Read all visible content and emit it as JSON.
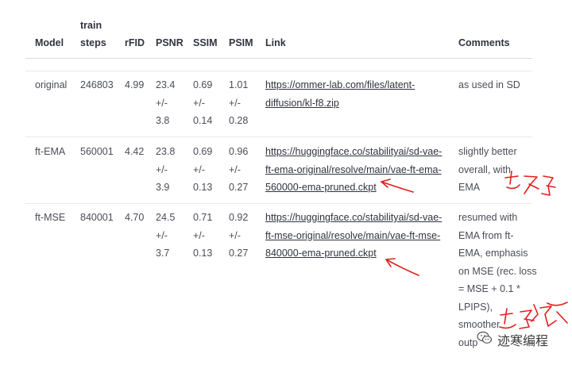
{
  "table": {
    "headers": {
      "model": "Model",
      "train_line1": "train",
      "train_line2": "steps",
      "rfid": "rFID",
      "psnr": "PSNR",
      "ssim": "SSIM",
      "psim": "PSIM",
      "link": "Link",
      "comments": "Comments"
    },
    "rows": [
      {
        "model": "original",
        "steps": "246803",
        "rfid": "4.99",
        "psnr": [
          "23.4",
          "+/-",
          "3.8"
        ],
        "ssim": [
          "0.69",
          "+/-",
          "0.14"
        ],
        "psim": [
          "1.01",
          "+/-",
          "0.28"
        ],
        "link": [
          "https://ommer-lab.com/files/latent-",
          "diffusion/kl-f8.zip"
        ],
        "comments": [
          "as used in SD"
        ]
      },
      {
        "model": "ft-EMA",
        "steps": "560001",
        "rfid": "4.42",
        "psnr": [
          "23.8",
          "+/-",
          "3.9"
        ],
        "ssim": [
          "0.69",
          "+/-",
          "0.13"
        ],
        "psim": [
          "0.96",
          "+/-",
          "0.27"
        ],
        "link": [
          "https://huggingface.co/stabilityai/sd-vae-",
          "ft-ema-original/resolve/main/vae-ft-ema-",
          "560000-ema-pruned.ckpt"
        ],
        "comments": [
          "slightly better",
          "overall, with",
          "EMA"
        ]
      },
      {
        "model": "ft-MSE",
        "steps": "840001",
        "rfid": "4.70",
        "psnr": [
          "24.5",
          "+/-",
          "3.7"
        ],
        "ssim": [
          "0.71",
          "+/-",
          "0.13"
        ],
        "psim": [
          "0.92",
          "+/-",
          "0.27"
        ],
        "link": [
          "https://huggingface.co/stabilityai/sd-vae-",
          "ft-mse-original/resolve/main/vae-ft-mse-",
          "840000-ema-pruned.ckpt"
        ],
        "comments": [
          "resumed with",
          "EMA from ft-",
          "EMA, emphasis",
          "on MSE (rec. loss",
          "= MSE + 0.1 *",
          "LPIPS),",
          "smoother",
          "outp"
        ]
      }
    ]
  },
  "annotations": {
    "color": "#e0201b"
  },
  "watermark": {
    "text": "迹寒编程",
    "icon": "wechat-icon"
  }
}
